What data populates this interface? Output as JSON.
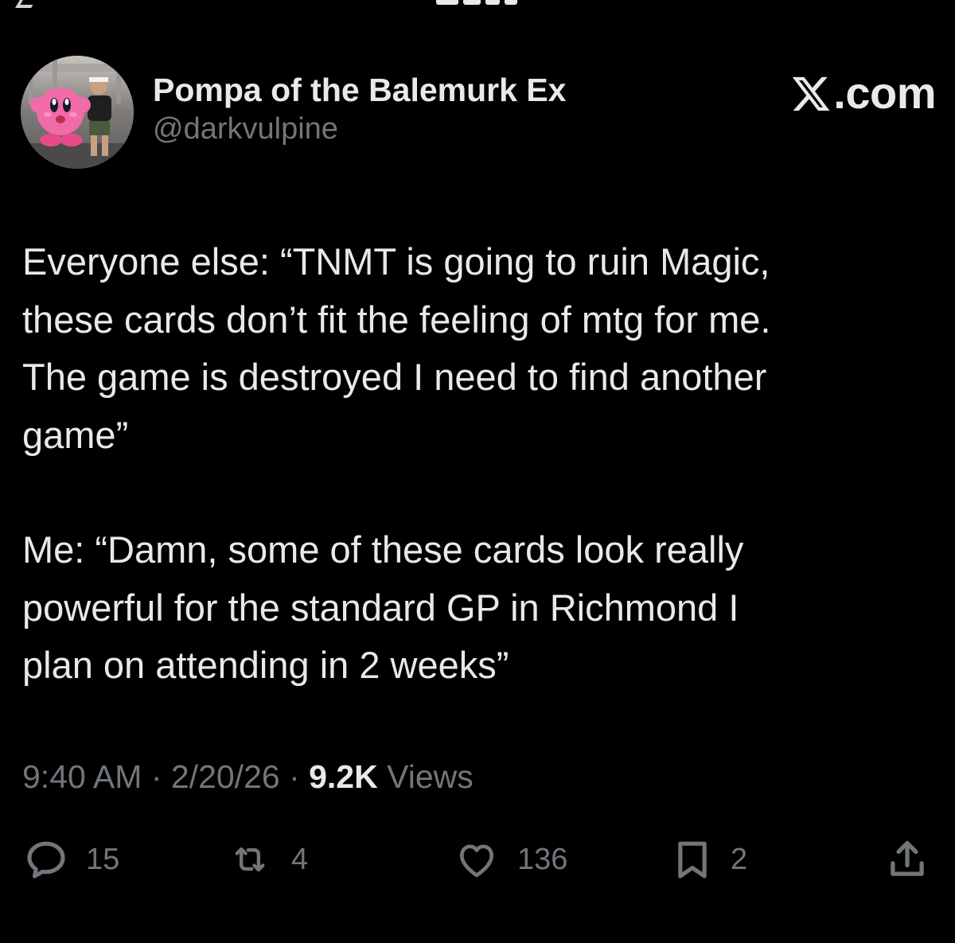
{
  "author": {
    "display_name": "Pompa of the Balemurk Ex",
    "handle": "@darkvulpine"
  },
  "brand": {
    "text": ".com",
    "logo_icon": "x-logo-icon"
  },
  "post": {
    "paragraphs": [
      "Everyone else: “TNMT is going to ruin Magic,\nthese cards don’t fit the feeling of mtg for me.\nThe game is destroyed I need to find another\ngame”",
      "Me: “Damn, some of these cards look really\npowerful for the standard GP in Richmond I\nplan on attending in 2 weeks”"
    ]
  },
  "meta": {
    "time": "9:40 AM",
    "separator": " · ",
    "date": "2/20/26",
    "views_count": "9.2K",
    "views_label": "Views"
  },
  "actions": {
    "replies": {
      "icon": "reply-icon",
      "count": "15"
    },
    "reposts": {
      "icon": "repost-icon",
      "count": "4"
    },
    "likes": {
      "icon": "heart-icon",
      "count": "136"
    },
    "bookmarks": {
      "icon": "bookmark-icon",
      "count": "2"
    },
    "share": {
      "icon": "share-icon"
    }
  },
  "colors": {
    "background": "#000000",
    "text_primary": "#e7e9ea",
    "text_secondary": "#71767b",
    "avatar_character": "#f06ba8"
  }
}
